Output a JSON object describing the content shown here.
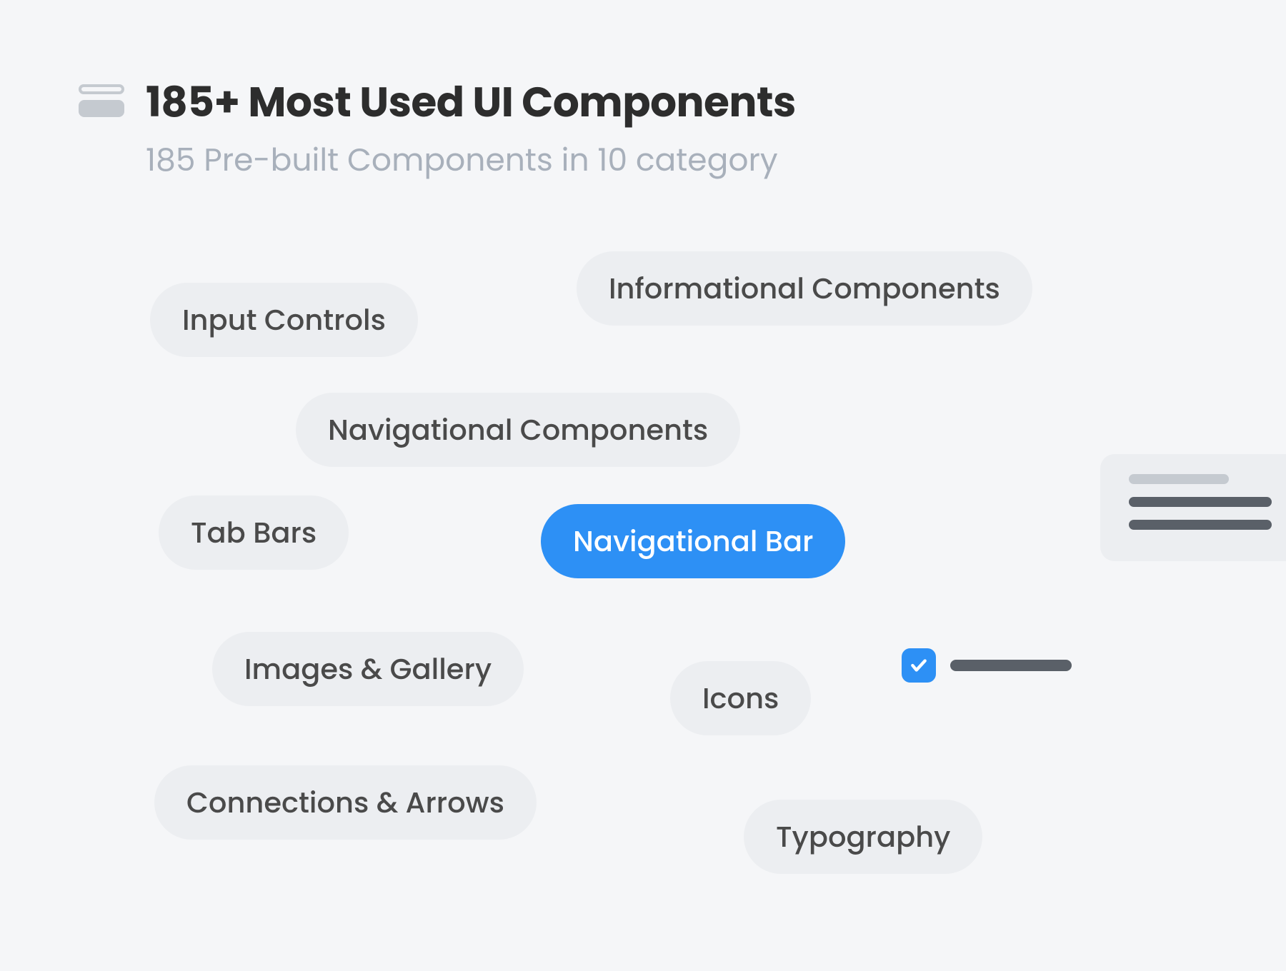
{
  "header": {
    "title": "185+ Most Used UI Components",
    "subtitle": "185 Pre-built Components in 10 category"
  },
  "chips": {
    "input_controls": "Input Controls",
    "informational": "Informational Components",
    "navigational_components": "Navigational Components",
    "tab_bars": "Tab Bars",
    "navigational_bar": "Navigational Bar",
    "images_gallery": "Images & Gallery",
    "icons": "Icons",
    "connections": "Connections & Arrows",
    "typography": "Typography"
  }
}
